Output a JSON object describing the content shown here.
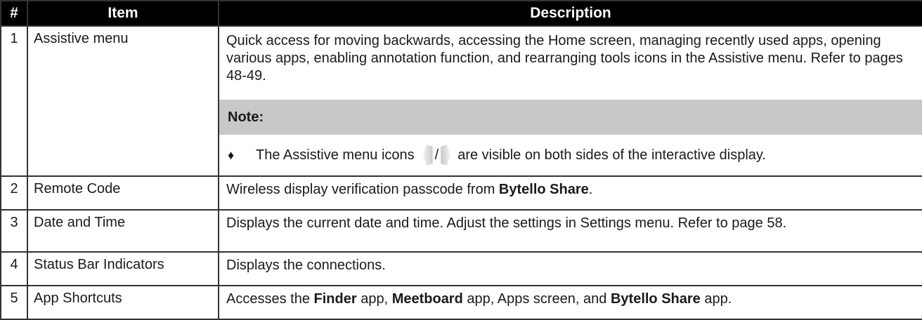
{
  "header": {
    "num": "#",
    "item": "Item",
    "description": "Description"
  },
  "rows": [
    {
      "num": "1",
      "item": "Assistive menu",
      "description": "Quick access for moving backwards, accessing the Home screen, managing recently used apps, opening various apps, enabling annotation function, and rearranging tools icons in the Assistive menu. Refer to pages 48-49.",
      "note": {
        "label": "Note:",
        "bullet": "♦",
        "text_before": "The Assistive menu icons",
        "separator": "/",
        "text_after": "are visible on both sides of the interactive display.",
        "icons": [
          "assistive-menu-left-icon",
          "assistive-menu-right-icon"
        ]
      }
    },
    {
      "num": "2",
      "item": "Remote Code",
      "desc_part1": "Wireless display verification passcode from ",
      "desc_bold1": "Bytello Share",
      "desc_part2": "."
    },
    {
      "num": "3",
      "item": "Date and Time",
      "description": "Displays the current date and time. Adjust the settings in Settings menu. Refer to page 58."
    },
    {
      "num": "4",
      "item": "Status Bar Indicators",
      "description": "Displays the connections."
    },
    {
      "num": "5",
      "item": "App Shortcuts",
      "desc_part1": "Accesses the ",
      "desc_bold1": "Finder",
      "desc_part2": " app, ",
      "desc_bold2": "Meetboard",
      "desc_part3": " app, Apps screen, and ",
      "desc_bold3": "Bytello Share",
      "desc_part4": " app."
    }
  ]
}
